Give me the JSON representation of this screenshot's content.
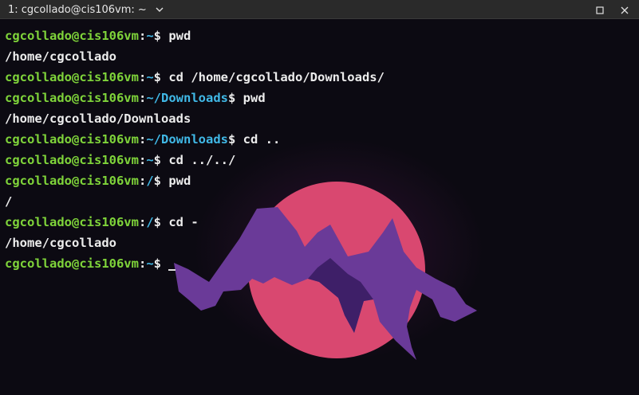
{
  "window": {
    "title": "1: cgcollado@cis106vm: ~"
  },
  "theme": {
    "prompt_user_color": "#7fd43a",
    "prompt_path_color": "#40b8e6",
    "text_color": "#ececec",
    "sun_color": "#d94870",
    "mountain_color": "#6a3a98"
  },
  "terminal": {
    "lines": [
      {
        "type": "prompt",
        "user": "cgcollado@cis106vm",
        "sep": ":",
        "path": "~",
        "symbol": "$",
        "cmd": " pwd"
      },
      {
        "type": "output",
        "text": "/home/cgcollado"
      },
      {
        "type": "prompt",
        "user": "cgcollado@cis106vm",
        "sep": ":",
        "path": "~",
        "symbol": "$",
        "cmd": " cd /home/cgcollado/Downloads/"
      },
      {
        "type": "prompt",
        "user": "cgcollado@cis106vm",
        "sep": ":",
        "path": "~/Downloads",
        "symbol": "$",
        "cmd": " pwd"
      },
      {
        "type": "output",
        "text": "/home/cgcollado/Downloads"
      },
      {
        "type": "prompt",
        "user": "cgcollado@cis106vm",
        "sep": ":",
        "path": "~/Downloads",
        "symbol": "$",
        "cmd": " cd .."
      },
      {
        "type": "prompt",
        "user": "cgcollado@cis106vm",
        "sep": ":",
        "path": "~",
        "symbol": "$",
        "cmd": " cd ../../"
      },
      {
        "type": "prompt",
        "user": "cgcollado@cis106vm",
        "sep": ":",
        "path": "/",
        "symbol": "$",
        "cmd": " pwd"
      },
      {
        "type": "output",
        "text": "/"
      },
      {
        "type": "prompt",
        "user": "cgcollado@cis106vm",
        "sep": ":",
        "path": "/",
        "symbol": "$",
        "cmd": " cd -"
      },
      {
        "type": "output",
        "text": "/home/cgcollado"
      },
      {
        "type": "prompt",
        "user": "cgcollado@cis106vm",
        "sep": ":",
        "path": "~",
        "symbol": "$",
        "cmd": " ",
        "cursor": true
      }
    ]
  },
  "icons": {
    "tab_menu": "chevron-down-icon",
    "maximize": "maximize-icon",
    "close": "close-icon"
  }
}
